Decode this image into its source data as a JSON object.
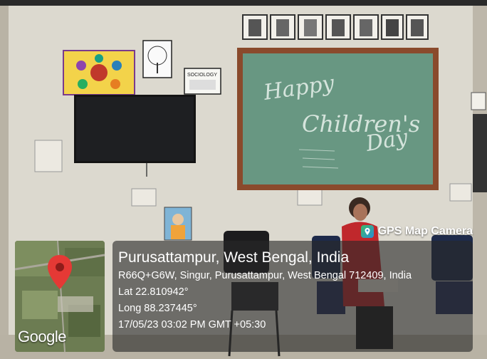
{
  "app": {
    "name": "GPS Map Camera",
    "icon": "gps-map-camera-icon",
    "accent": "#2b8cd6"
  },
  "map": {
    "provider_logo": "Google",
    "pin_color": "#e53935",
    "pin_icon": "map-pin-icon"
  },
  "location": {
    "title": "Purusattampur, West Bengal, India",
    "address": "R66Q+G6W, Singur, Purusattampur, West Bengal 712409, India",
    "lat": "Lat 22.810942°",
    "long": "Long 88.237445°",
    "timestamp": "17/05/23 03:02 PM GMT +05:30"
  },
  "scene": {
    "blackboard_text": [
      "Happy",
      "Children's",
      "Day"
    ],
    "poster_label": "SOCIOLOGY"
  }
}
